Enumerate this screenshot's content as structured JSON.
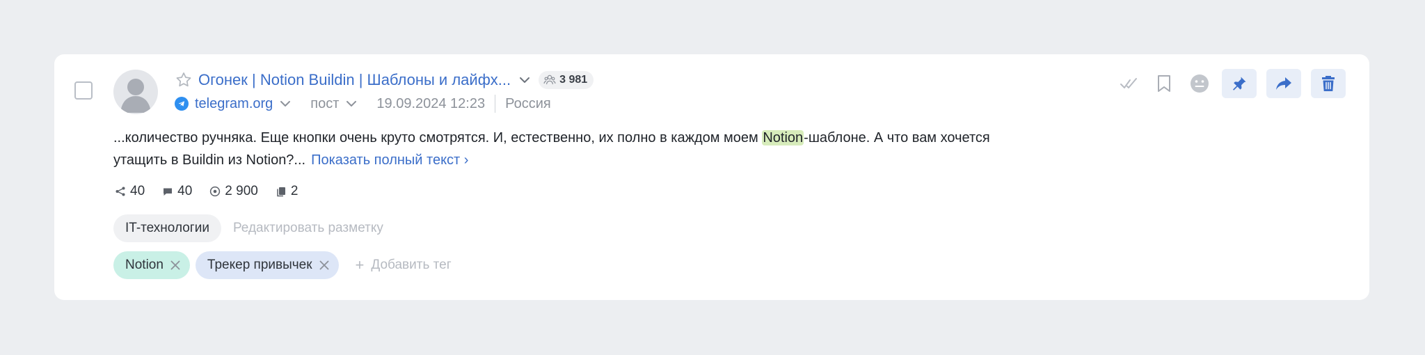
{
  "post": {
    "channel_title": "Огонек | Notion Buildin | Шаблоны и лайфх...",
    "subscribers": "3 981",
    "source": "telegram.org",
    "post_type": "пост",
    "datetime": "19.09.2024 12:23",
    "country": "Россия",
    "text_before": "...количество ручняка. Еще кнопки очень круто смотрятся. И, естественно, их полно в каждом моем ",
    "text_highlight": "Notion",
    "text_after": "-шаблоне. А что вам хочется утащить в Buildin из Notion?...",
    "show_more": "Показать полный текст ›"
  },
  "stats": {
    "reposts": "40",
    "comments": "40",
    "views": "2 900",
    "copies": "2"
  },
  "rubric": {
    "label": "IT-технологии",
    "edit_label": "Редактировать разметку"
  },
  "tags": [
    {
      "label": "Notion",
      "color": "#c9f0e6"
    },
    {
      "label": "Трекер привычек",
      "color": "#dde6f7"
    }
  ],
  "add_tag_label": "Добавить тег",
  "colors": {
    "accent": "#3b6ec9",
    "highlight": "#d7ecbb",
    "telegram": "#2e8ff0"
  },
  "icons": [
    "star-icon",
    "chevron-down-icon",
    "subscribers-icon",
    "telegram-icon",
    "repost-icon",
    "comment-icon",
    "eye-icon",
    "copy-icon",
    "close-icon",
    "check-icon",
    "bookmark-icon",
    "neutral-face-icon",
    "pin-icon",
    "share-icon",
    "trash-icon"
  ]
}
